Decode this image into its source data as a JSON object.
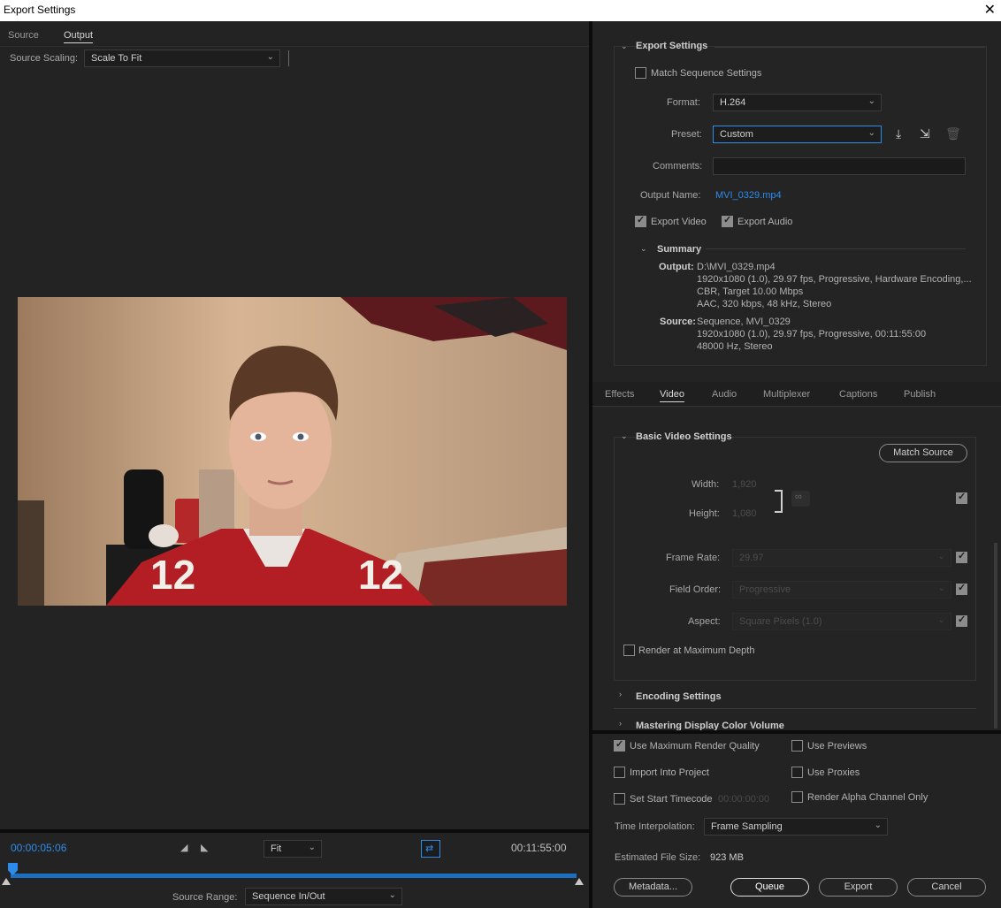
{
  "window": {
    "title": "Export Settings",
    "close_glyph": "✕"
  },
  "left": {
    "tabs": [
      "Source",
      "Output"
    ],
    "source_scaling_label": "Source Scaling:",
    "source_scaling_value": "Scale To Fit",
    "timecode_current": "00:00:05:06",
    "timecode_end": "00:11:55:00",
    "zoom_value": "Fit",
    "source_range_label": "Source Range:",
    "source_range_value": "Sequence In/Out",
    "playhead_progress": 0.007
  },
  "export_settings": {
    "section_title": "Export Settings",
    "match_sequence_label": "Match Sequence Settings",
    "match_sequence_checked": false,
    "format_label": "Format:",
    "format_value": "H.264",
    "preset_label": "Preset:",
    "preset_value": "Custom",
    "comments_label": "Comments:",
    "comments_value": "",
    "output_name_label": "Output Name:",
    "output_name_value": "MVI_0329.mp4",
    "export_video_label": "Export Video",
    "export_audio_label": "Export Audio",
    "summary_title": "Summary",
    "summary_output_label": "Output:",
    "summary_output_lines": [
      "D:\\MVI_0329.mp4",
      "1920x1080 (1.0), 29.97 fps, Progressive, Hardware Encoding,...",
      "CBR, Target 10.00 Mbps",
      "AAC, 320 kbps, 48 kHz, Stereo"
    ],
    "summary_source_label": "Source:",
    "summary_source_lines": [
      "Sequence, MVI_0329",
      "1920x1080 (1.0), 29.97 fps, Progressive, 00:11:55:00",
      "48000 Hz, Stereo"
    ]
  },
  "tabs": [
    "Effects",
    "Video",
    "Audio",
    "Multiplexer",
    "Captions",
    "Publish"
  ],
  "active_tab": "Video",
  "basic_video": {
    "section_title": "Basic Video Settings",
    "match_source_label": "Match Source",
    "width_label": "Width:",
    "width_value": "1,920",
    "height_label": "Height:",
    "height_value": "1,080",
    "frame_rate_label": "Frame Rate:",
    "frame_rate_value": "29.97",
    "field_order_label": "Field Order:",
    "field_order_value": "Progressive",
    "aspect_label": "Aspect:",
    "aspect_value": "Square Pixels (1.0)",
    "render_max_depth_label": "Render at Maximum Depth"
  },
  "collapsed_sections": [
    "Encoding Settings",
    "Mastering Display Color Volume"
  ],
  "bottom": {
    "use_max_render_quality": "Use Maximum Render Quality",
    "use_previews": "Use Previews",
    "import_into_project": "Import Into Project",
    "use_proxies": "Use Proxies",
    "set_start_timecode": "Set Start Timecode",
    "start_timecode_value": "00:00:00:00",
    "render_alpha_only": "Render Alpha Channel Only",
    "time_interpolation_label": "Time Interpolation:",
    "time_interpolation_value": "Frame Sampling",
    "estimated_size_label": "Estimated File Size:",
    "estimated_size_value": "923 MB",
    "metadata_button": "Metadata...",
    "queue_button": "Queue",
    "export_button": "Export",
    "cancel_button": "Cancel"
  },
  "colors": {
    "accent": "#2d8ceb",
    "background": "#232323",
    "panel_divider": "#0b0b0b"
  }
}
